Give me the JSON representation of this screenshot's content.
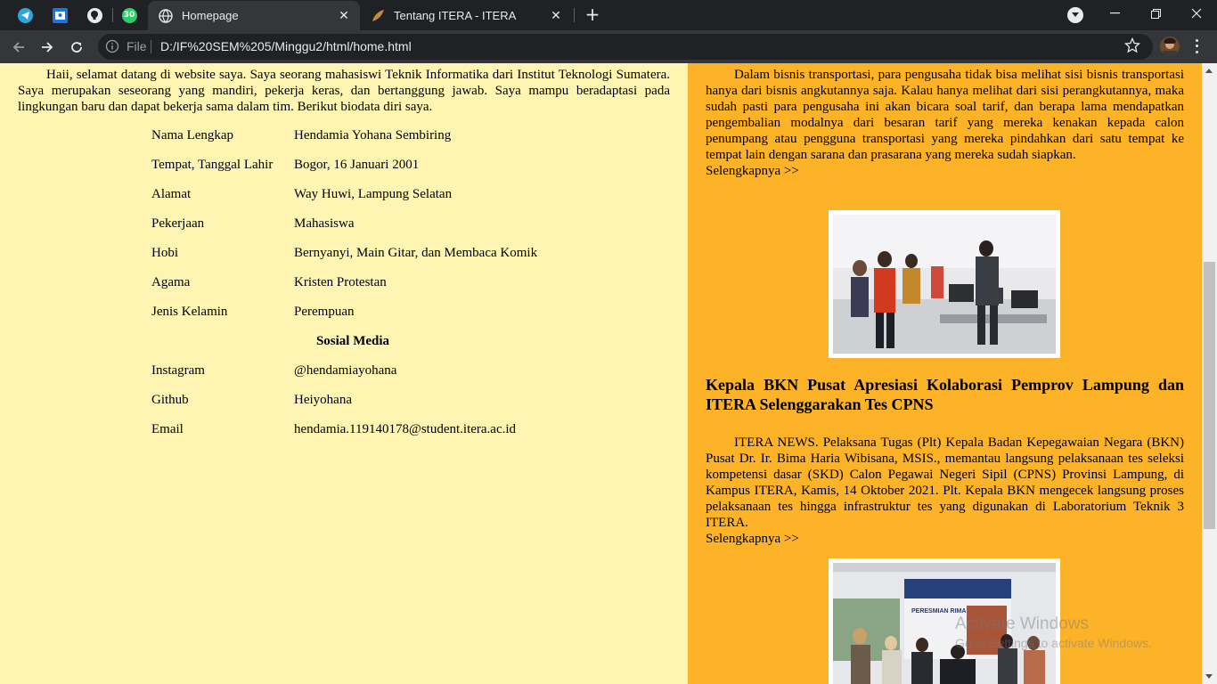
{
  "browser": {
    "tabs": [
      {
        "title": "Homepage",
        "active": true
      },
      {
        "title": "Tentang ITERA - ITERA",
        "active": false
      }
    ],
    "whatsapp_badge": "30",
    "address": {
      "scheme": "File",
      "url": "D:/IF%20SEM%205/Minggu2/html/home.html"
    }
  },
  "left": {
    "intro": "Haii, selamat datang di website saya. Saya seorang mahasiswi Teknik Informatika dari Institut Teknologi Sumatera. Saya merupakan seseorang yang mandiri, pekerja keras, dan bertanggung jawab. Saya mampu beradaptasi pada lingkungan baru dan dapat bekerja sama dalam tim. Berikut biodata diri saya.",
    "bio": [
      {
        "label": "Nama Lengkap",
        "value": "Hendamia Yohana Sembiring"
      },
      {
        "label": "Tempat, Tanggal Lahir",
        "value": "Bogor, 16 Januari 2001"
      },
      {
        "label": "Alamat",
        "value": "Way Huwi, Lampung Selatan"
      },
      {
        "label": "Pekerjaan",
        "value": "Mahasiswa"
      },
      {
        "label": "Hobi",
        "value": "Bernyanyi, Main Gitar, dan Membaca Komik"
      },
      {
        "label": "Agama",
        "value": "Kristen Protestan"
      },
      {
        "label": "Jenis Kelamin",
        "value": "Perempuan"
      }
    ],
    "social_heading": "Sosial Media",
    "social": [
      {
        "label": "Instagram",
        "value": "@hendamiayohana"
      },
      {
        "label": "Github",
        "value": "Heiyohana"
      },
      {
        "label": "Email",
        "value": "hendamia.119140178@student.itera.ac.id"
      }
    ]
  },
  "right": {
    "article1_text": "Dalam bisnis transportasi, para pengusaha tidak bisa melihat sisi bisnis transportasi hanya dari bisnis angkutannya saja. Kalau hanya melihat dari sisi perangkutannya, maka sudah pasti para pengusaha ini akan bicara soal tarif, dan berapa lama mendapatkan pengembalian modalnya dari besaran tarif yang mereka kenakan kepada calon penumpang atau pengguna transportasi yang mereka pindahkan dari satu tempat ke tempat lain dengan sarana dan prasarana yang mereka sudah siapkan.",
    "more_label": "Selengkapnya >>",
    "article2_title": "Kepala BKN Pusat Apresiasi Kolaborasi Pemprov Lampung dan ITERA Selenggarakan Tes CPNS",
    "article2_text": "ITERA NEWS. Pelaksana Tugas (Plt) Kepala Badan Kepegawaian Negara (BKN) Pusat Dr. Ir. Bima Haria Wibisana, MSIS., memantau langsung pelaksanaan tes seleksi kompetensi dasar (SKD) Calon Pegawai Negeri Sipil (CPNS) Provinsi Lampung, di Kampus ITERA, Kamis, 14 Oktober 2021. Plt. Kepala BKN mengecek langsung proses pelaksanaan tes hingga infrastruktur tes yang digunakan di Laboratorium Teknik 3 ITERA.",
    "photo2_banner": "PERESMIAN RIMA"
  },
  "watermark": {
    "line1": "Activate Windows",
    "line2": "Go to Settings to activate Windows."
  },
  "colors": {
    "left_bg": "#fff5b3",
    "right_bg": "#fdb328",
    "chrome_dark": "#202124",
    "chrome_toolbar": "#35363a"
  }
}
